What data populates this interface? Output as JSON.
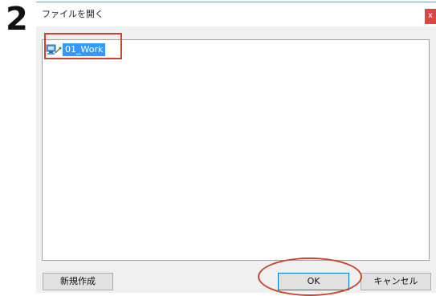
{
  "step": {
    "number": "2"
  },
  "dialog": {
    "title": "ファイルを開く",
    "close_label": "x",
    "tree": {
      "items": [
        {
          "label": "01_Work",
          "icon": "folder-network-icon",
          "selected": true
        }
      ]
    },
    "buttons": {
      "new_label": "新規作成",
      "ok_label": "OK",
      "cancel_label": "キャンセル"
    }
  },
  "colors": {
    "selection": "#3399ff",
    "annotation": "#c9452e",
    "close_button": "#e04343"
  }
}
